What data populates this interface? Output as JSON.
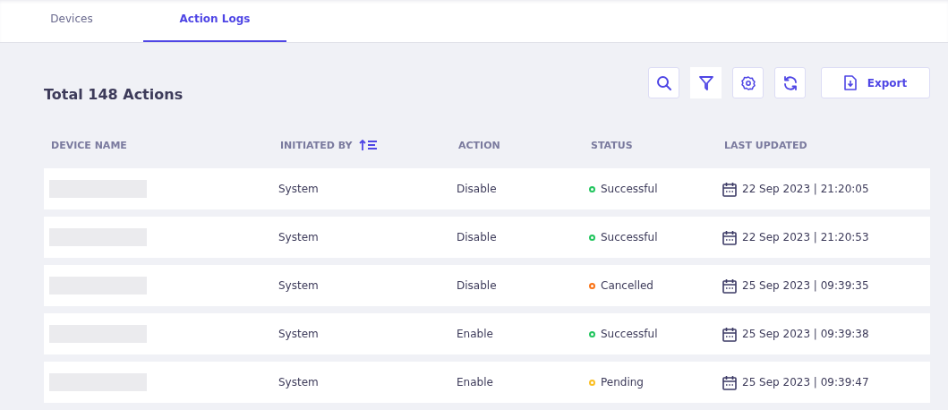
{
  "tabs": [
    {
      "label": "Devices",
      "selected": false
    },
    {
      "label": "Action Logs",
      "selected": true
    }
  ],
  "title": "Total 148 Actions",
  "toolbar": {
    "export_label": "Export"
  },
  "table": {
    "columns": [
      {
        "label": "DEVICE NAME",
        "sorted": false
      },
      {
        "label": "INITIATED BY",
        "sorted": true
      },
      {
        "label": "ACTION",
        "sorted": false
      },
      {
        "label": "STATUS",
        "sorted": false
      },
      {
        "label": "LAST UPDATED",
        "sorted": false
      }
    ],
    "rows": [
      {
        "initiated_by": "System",
        "action": "Disable",
        "status": "Successful",
        "color": "#22c55e",
        "last_updated": "22 Sep 2023 | 21:20:05"
      },
      {
        "initiated_by": "System",
        "action": "Disable",
        "status": "Successful",
        "color": "#22c55e",
        "last_updated": "22 Sep 2023 | 21:20:53"
      },
      {
        "initiated_by": "System",
        "action": "Disable",
        "status": "Cancelled",
        "color": "#f97316",
        "last_updated": "25 Sep 2023 | 09:39:35"
      },
      {
        "initiated_by": "System",
        "action": "Enable",
        "status": "Successful",
        "color": "#22c55e",
        "last_updated": "25 Sep 2023 | 09:39:38"
      },
      {
        "initiated_by": "System",
        "action": "Enable",
        "status": "Pending",
        "color": "#fbbf24",
        "last_updated": "25 Sep 2023 | 09:39:47"
      }
    ]
  }
}
